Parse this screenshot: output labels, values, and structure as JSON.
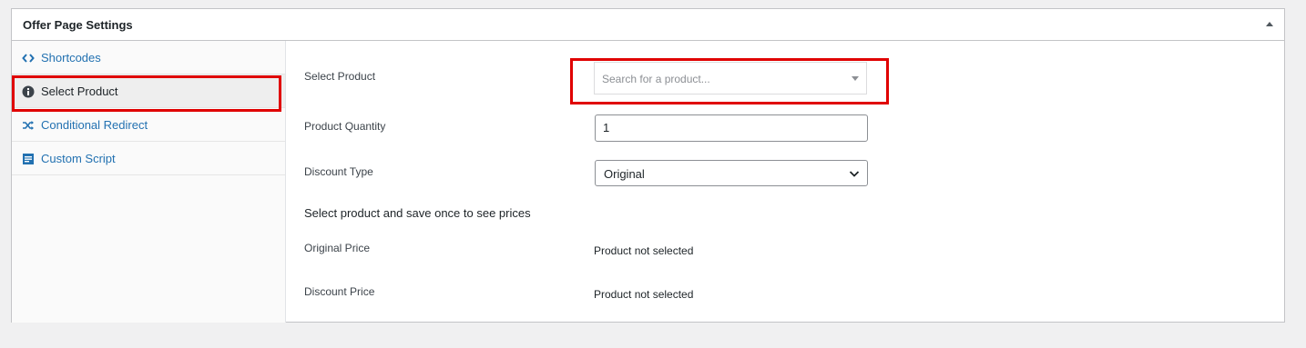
{
  "panel": {
    "title": "Offer Page Settings"
  },
  "sidebar": {
    "items": [
      {
        "label": "Shortcodes",
        "icon": "code-icon"
      },
      {
        "label": "Select Product",
        "icon": "info-icon",
        "active": true
      },
      {
        "label": "Conditional Redirect",
        "icon": "shuffle-icon"
      },
      {
        "label": "Custom Script",
        "icon": "script-icon"
      }
    ]
  },
  "form": {
    "select_product": {
      "label": "Select Product",
      "placeholder": "Search for a product..."
    },
    "quantity": {
      "label": "Product Quantity",
      "value": "1"
    },
    "discount_type": {
      "label": "Discount Type",
      "value": "Original"
    },
    "notice": "Select product and save once to see prices",
    "original_price": {
      "label": "Original Price",
      "value": "Product not selected"
    },
    "discount_price": {
      "label": "Discount Price",
      "value": "Product not selected"
    }
  },
  "colors": {
    "link": "#2271b1",
    "highlight": "#e00000",
    "active_tab_bg": "#eeeeee"
  }
}
